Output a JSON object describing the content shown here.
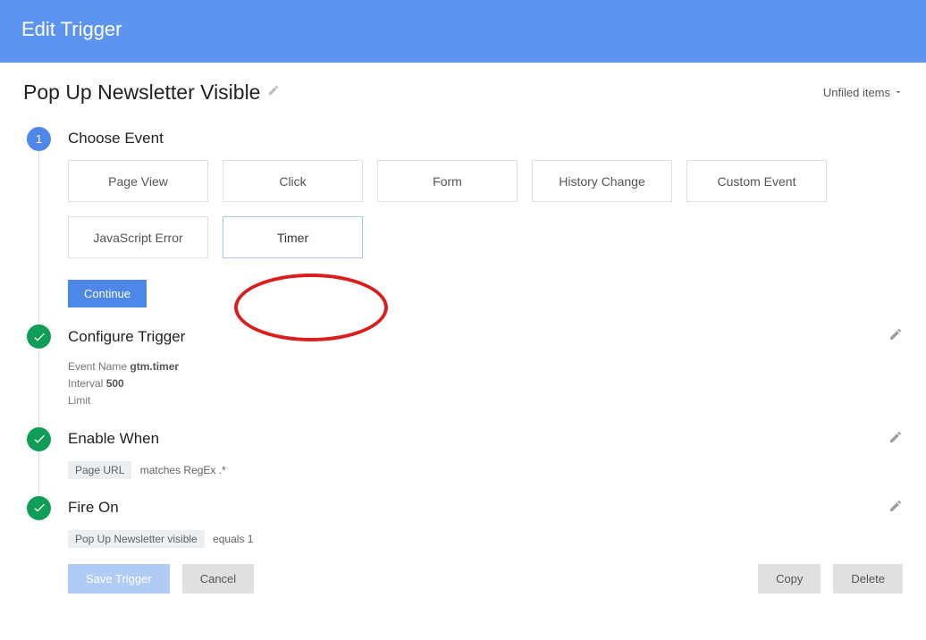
{
  "header": {
    "title": "Edit Trigger"
  },
  "page": {
    "title": "Pop Up Newsletter Visible",
    "folder_label": "Unfiled items"
  },
  "steps": {
    "choose_event": {
      "marker": "1",
      "title": "Choose Event",
      "events": {
        "page_view": "Page View",
        "click": "Click",
        "form": "Form",
        "history_change": "History Change",
        "custom_event": "Custom Event",
        "js_error": "JavaScript Error",
        "timer": "Timer"
      },
      "continue": "Continue"
    },
    "configure": {
      "title": "Configure Trigger",
      "lines": {
        "event_name_label": "Event Name",
        "event_name_value": "gtm.timer",
        "interval_label": "Interval",
        "interval_value": "500",
        "limit_label": "Limit"
      }
    },
    "enable_when": {
      "title": "Enable When",
      "chip": "Page URL",
      "condition": "matches RegEx .*"
    },
    "fire_on": {
      "title": "Fire On",
      "chip": "Pop Up Newsletter visible",
      "condition": "equals 1"
    }
  },
  "footer": {
    "save": "Save Trigger",
    "cancel": "Cancel",
    "copy": "Copy",
    "delete": "Delete"
  }
}
